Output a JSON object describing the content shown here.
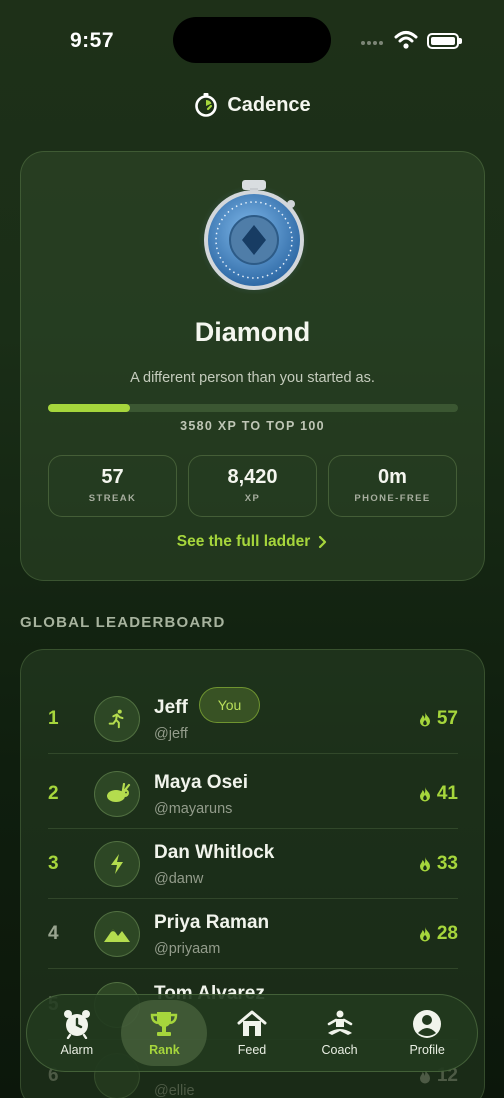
{
  "status_bar": {
    "time": "9:57"
  },
  "app": {
    "title": "Cadence"
  },
  "rank_card": {
    "tier": "Diamond",
    "subtitle": "A different person than you started as.",
    "progress": {
      "fraction": 0.2,
      "label": "3580 XP TO TOP 100"
    },
    "stats": [
      {
        "value": "57",
        "label": "STREAK"
      },
      {
        "value": "8,420",
        "label": "XP"
      },
      {
        "value": "0m",
        "label": "PHONE-FREE"
      }
    ],
    "ladder_link": "See the full ladder"
  },
  "leaderboard": {
    "title": "GLOBAL LEADERBOARD",
    "you_label": "You",
    "rows": [
      {
        "rank": "1",
        "name": "Jeff",
        "handle": "@jeff",
        "streak": "57",
        "icon": "runner-icon",
        "is_you": true
      },
      {
        "rank": "2",
        "name": "Maya Osei",
        "handle": "@mayaruns",
        "streak": "41",
        "icon": "rabbit-icon"
      },
      {
        "rank": "3",
        "name": "Dan Whitlock",
        "handle": "@danw",
        "streak": "33",
        "icon": "lightning-icon"
      },
      {
        "rank": "4",
        "name": "Priya Raman",
        "handle": "@priyaam",
        "streak": "28",
        "icon": "mountain-icon"
      },
      {
        "rank": "5",
        "name": "Tom Alvarez",
        "handle": "",
        "streak": "",
        "icon": ""
      },
      {
        "rank": "6",
        "name": "",
        "handle": "@ellie",
        "streak": "12",
        "icon": ""
      }
    ]
  },
  "tab_bar": {
    "tabs": [
      {
        "label": "Alarm",
        "icon": "alarm-clock-icon"
      },
      {
        "label": "Rank",
        "icon": "trophy-icon",
        "active": true
      },
      {
        "label": "Feed",
        "icon": "home-icon"
      },
      {
        "label": "Coach",
        "icon": "meditation-icon"
      },
      {
        "label": "Profile",
        "icon": "profile-icon"
      }
    ]
  },
  "colors": {
    "accent": "#a6d63c",
    "background": "#1a2e17"
  }
}
